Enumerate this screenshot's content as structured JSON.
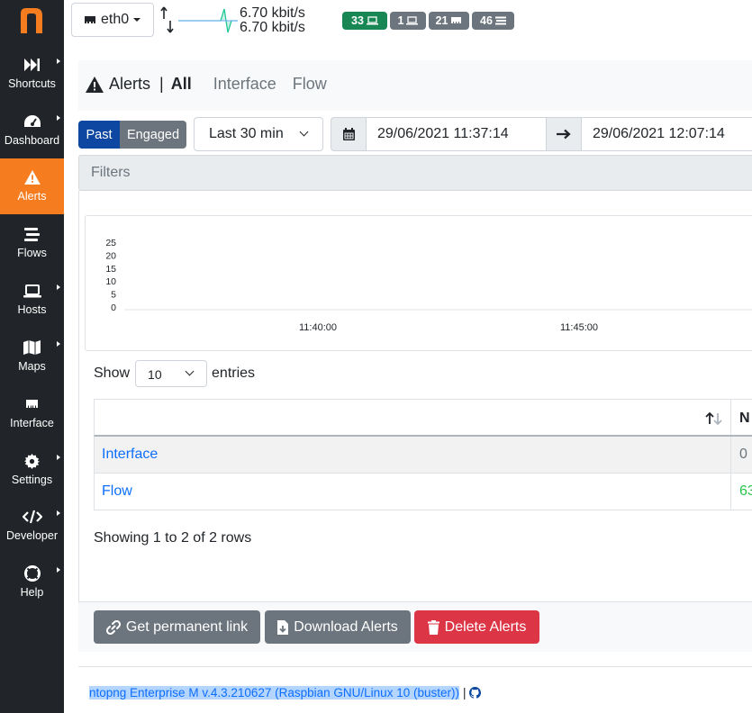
{
  "sidebar": {
    "logo": "n",
    "items": [
      {
        "label": "Shortcuts",
        "icon": "fast-forward-icon",
        "caret": true,
        "active": false
      },
      {
        "label": "Dashboard",
        "icon": "gauge-icon",
        "caret": true,
        "active": false
      },
      {
        "label": "Alerts",
        "icon": "warning-icon",
        "caret": false,
        "active": true
      },
      {
        "label": "Flows",
        "icon": "stream-icon",
        "caret": false,
        "active": false
      },
      {
        "label": "Hosts",
        "icon": "laptop-icon",
        "caret": true,
        "active": false
      },
      {
        "label": "Maps",
        "icon": "map-icon",
        "caret": true,
        "active": false
      },
      {
        "label": "Interface",
        "icon": "ethernet-icon",
        "caret": false,
        "active": false
      },
      {
        "label": "Settings",
        "icon": "gear-icon",
        "caret": true,
        "active": false
      },
      {
        "label": "Developer",
        "icon": "code-icon",
        "caret": true,
        "active": false
      },
      {
        "label": "Help",
        "icon": "lifebuoy-icon",
        "caret": true,
        "active": false
      }
    ],
    "accent": "#f57c1f",
    "background": "#212529"
  },
  "topbar": {
    "interface": "eth0",
    "rate_up": "6.70 kbit/s",
    "rate_down": "6.70 kbit/s",
    "badges": [
      {
        "value": "33",
        "icon": "laptop-icon",
        "color": "#198754"
      },
      {
        "value": "1",
        "icon": "laptop-icon",
        "color": "#6c757d"
      },
      {
        "value": "21",
        "icon": "ethernet-icon",
        "color": "#6c757d"
      },
      {
        "value": "46",
        "icon": "stream-icon",
        "color": "#6c757d"
      }
    ]
  },
  "header": {
    "title": "Alerts",
    "separator": "|",
    "tabs": [
      "All",
      "Interface",
      "Flow"
    ],
    "active_tab": "All"
  },
  "controls": {
    "past_label": "Past",
    "engaged_label": "Engaged",
    "range": "Last 30 min",
    "date_from": "29/06/2021 11:37:14",
    "date_to": "29/06/2021 12:07:14"
  },
  "filters": {
    "placeholder": "Filters"
  },
  "chart_data": {
    "type": "bar",
    "y_ticks": [
      "25",
      "20",
      "15",
      "10",
      "5",
      "0"
    ],
    "x_ticks": [
      "11:40:00",
      "11:45:00"
    ],
    "ylim": [
      0,
      25
    ],
    "series": []
  },
  "table": {
    "show_label": "Show",
    "entries_value": "10",
    "entries_label": "entries",
    "col2_header": "N",
    "sort_icon": "sort-icon",
    "rows": [
      {
        "name": "Interface",
        "count": "0",
        "count_color": "#6c757d"
      },
      {
        "name": "Flow",
        "count": "63",
        "count_color": "#198754"
      }
    ],
    "summary": "Showing 1 to 2 of 2 rows"
  },
  "actions": {
    "link_label": "Get permanent link",
    "download_label": "Download Alerts",
    "delete_label": "Delete Alerts",
    "delete_color": "#dc3545",
    "gray_color": "#6c757d"
  },
  "footer": {
    "version": "ntopng Enterprise M v.4.3.210627 (Raspbian GNU/Linux 10 (buster))",
    "separator": "|"
  }
}
